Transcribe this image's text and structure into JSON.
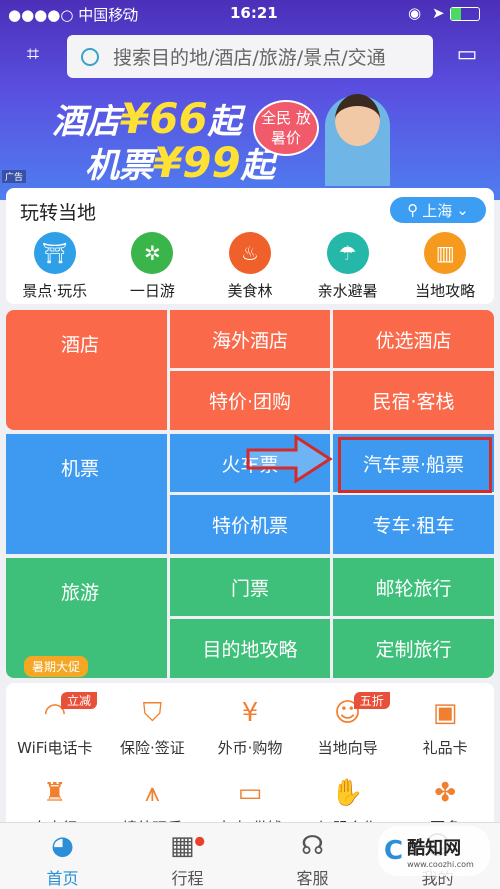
{
  "status": {
    "carrier": "●●●●○ 中国移动",
    "time": "16:21"
  },
  "search": {
    "placeholder": "搜索目的地/酒店/旅游/景点/交通"
  },
  "banner": {
    "line1": "酒店",
    "price1": "¥66",
    "suffix1": "起",
    "line2": "机票",
    "price2": "¥99",
    "suffix2": "起",
    "bubble": "全民 放暑价",
    "ad": "广告"
  },
  "local": {
    "title": "玩转当地",
    "city": "上海",
    "items": [
      {
        "label": "景点·玩乐",
        "icon": "attraction-icon",
        "color": "#2f9fe8"
      },
      {
        "label": "一日游",
        "icon": "ferris-wheel-icon",
        "color": "#3ab54a"
      },
      {
        "label": "美食林",
        "icon": "food-icon",
        "color": "#f0602a"
      },
      {
        "label": "亲水避暑",
        "icon": "beach-umbrella-icon",
        "color": "#25b8a8"
      },
      {
        "label": "当地攻略",
        "icon": "guide-book-icon",
        "color": "#f59a1d"
      }
    ]
  },
  "grid": {
    "hotel": {
      "main": "酒店",
      "c1": "海外酒店",
      "c2": "优选酒店",
      "c3": "特价·团购",
      "c4": "民宿·客栈",
      "color": "#fa6a4a"
    },
    "flight": {
      "main": "机票",
      "c1": "火车票",
      "c2": "汽车票·船票",
      "c3": "特价机票",
      "c4": "专车·租车",
      "color": "#3e9af0"
    },
    "travel": {
      "main": "旅游",
      "c1": "门票",
      "c2": "邮轮旅行",
      "c3": "目的地攻略",
      "c4": "定制旅行",
      "promo": "暑期大促",
      "color": "#3fc07a"
    }
  },
  "services": {
    "row1": [
      {
        "label": "WiFi电话卡",
        "icon": "wifi-icon",
        "tag": "立减"
      },
      {
        "label": "保险·签证",
        "icon": "shield-icon"
      },
      {
        "label": "外币·购物",
        "icon": "currency-bag-icon"
      },
      {
        "label": "当地向导",
        "icon": "guide-hat-icon",
        "tag": "五折"
      },
      {
        "label": "礼品卡",
        "icon": "gift-card-icon"
      }
    ],
    "row2": [
      {
        "label": "自由行",
        "icon": "backpack-icon"
      },
      {
        "label": "境外玩乐",
        "icon": "eiffel-tower-icon"
      },
      {
        "label": "办卡·借钱",
        "icon": "credit-card-icon"
      },
      {
        "label": "加盟合作",
        "icon": "handshake-icon"
      },
      {
        "label": "更多",
        "icon": "more-grid-icon"
      }
    ]
  },
  "tabs": [
    {
      "label": "首页",
      "active": true
    },
    {
      "label": "行程"
    },
    {
      "label": "客服"
    },
    {
      "label": "我的"
    }
  ],
  "watermark": {
    "name": "酷知网",
    "url": "www.coozhi.com"
  }
}
